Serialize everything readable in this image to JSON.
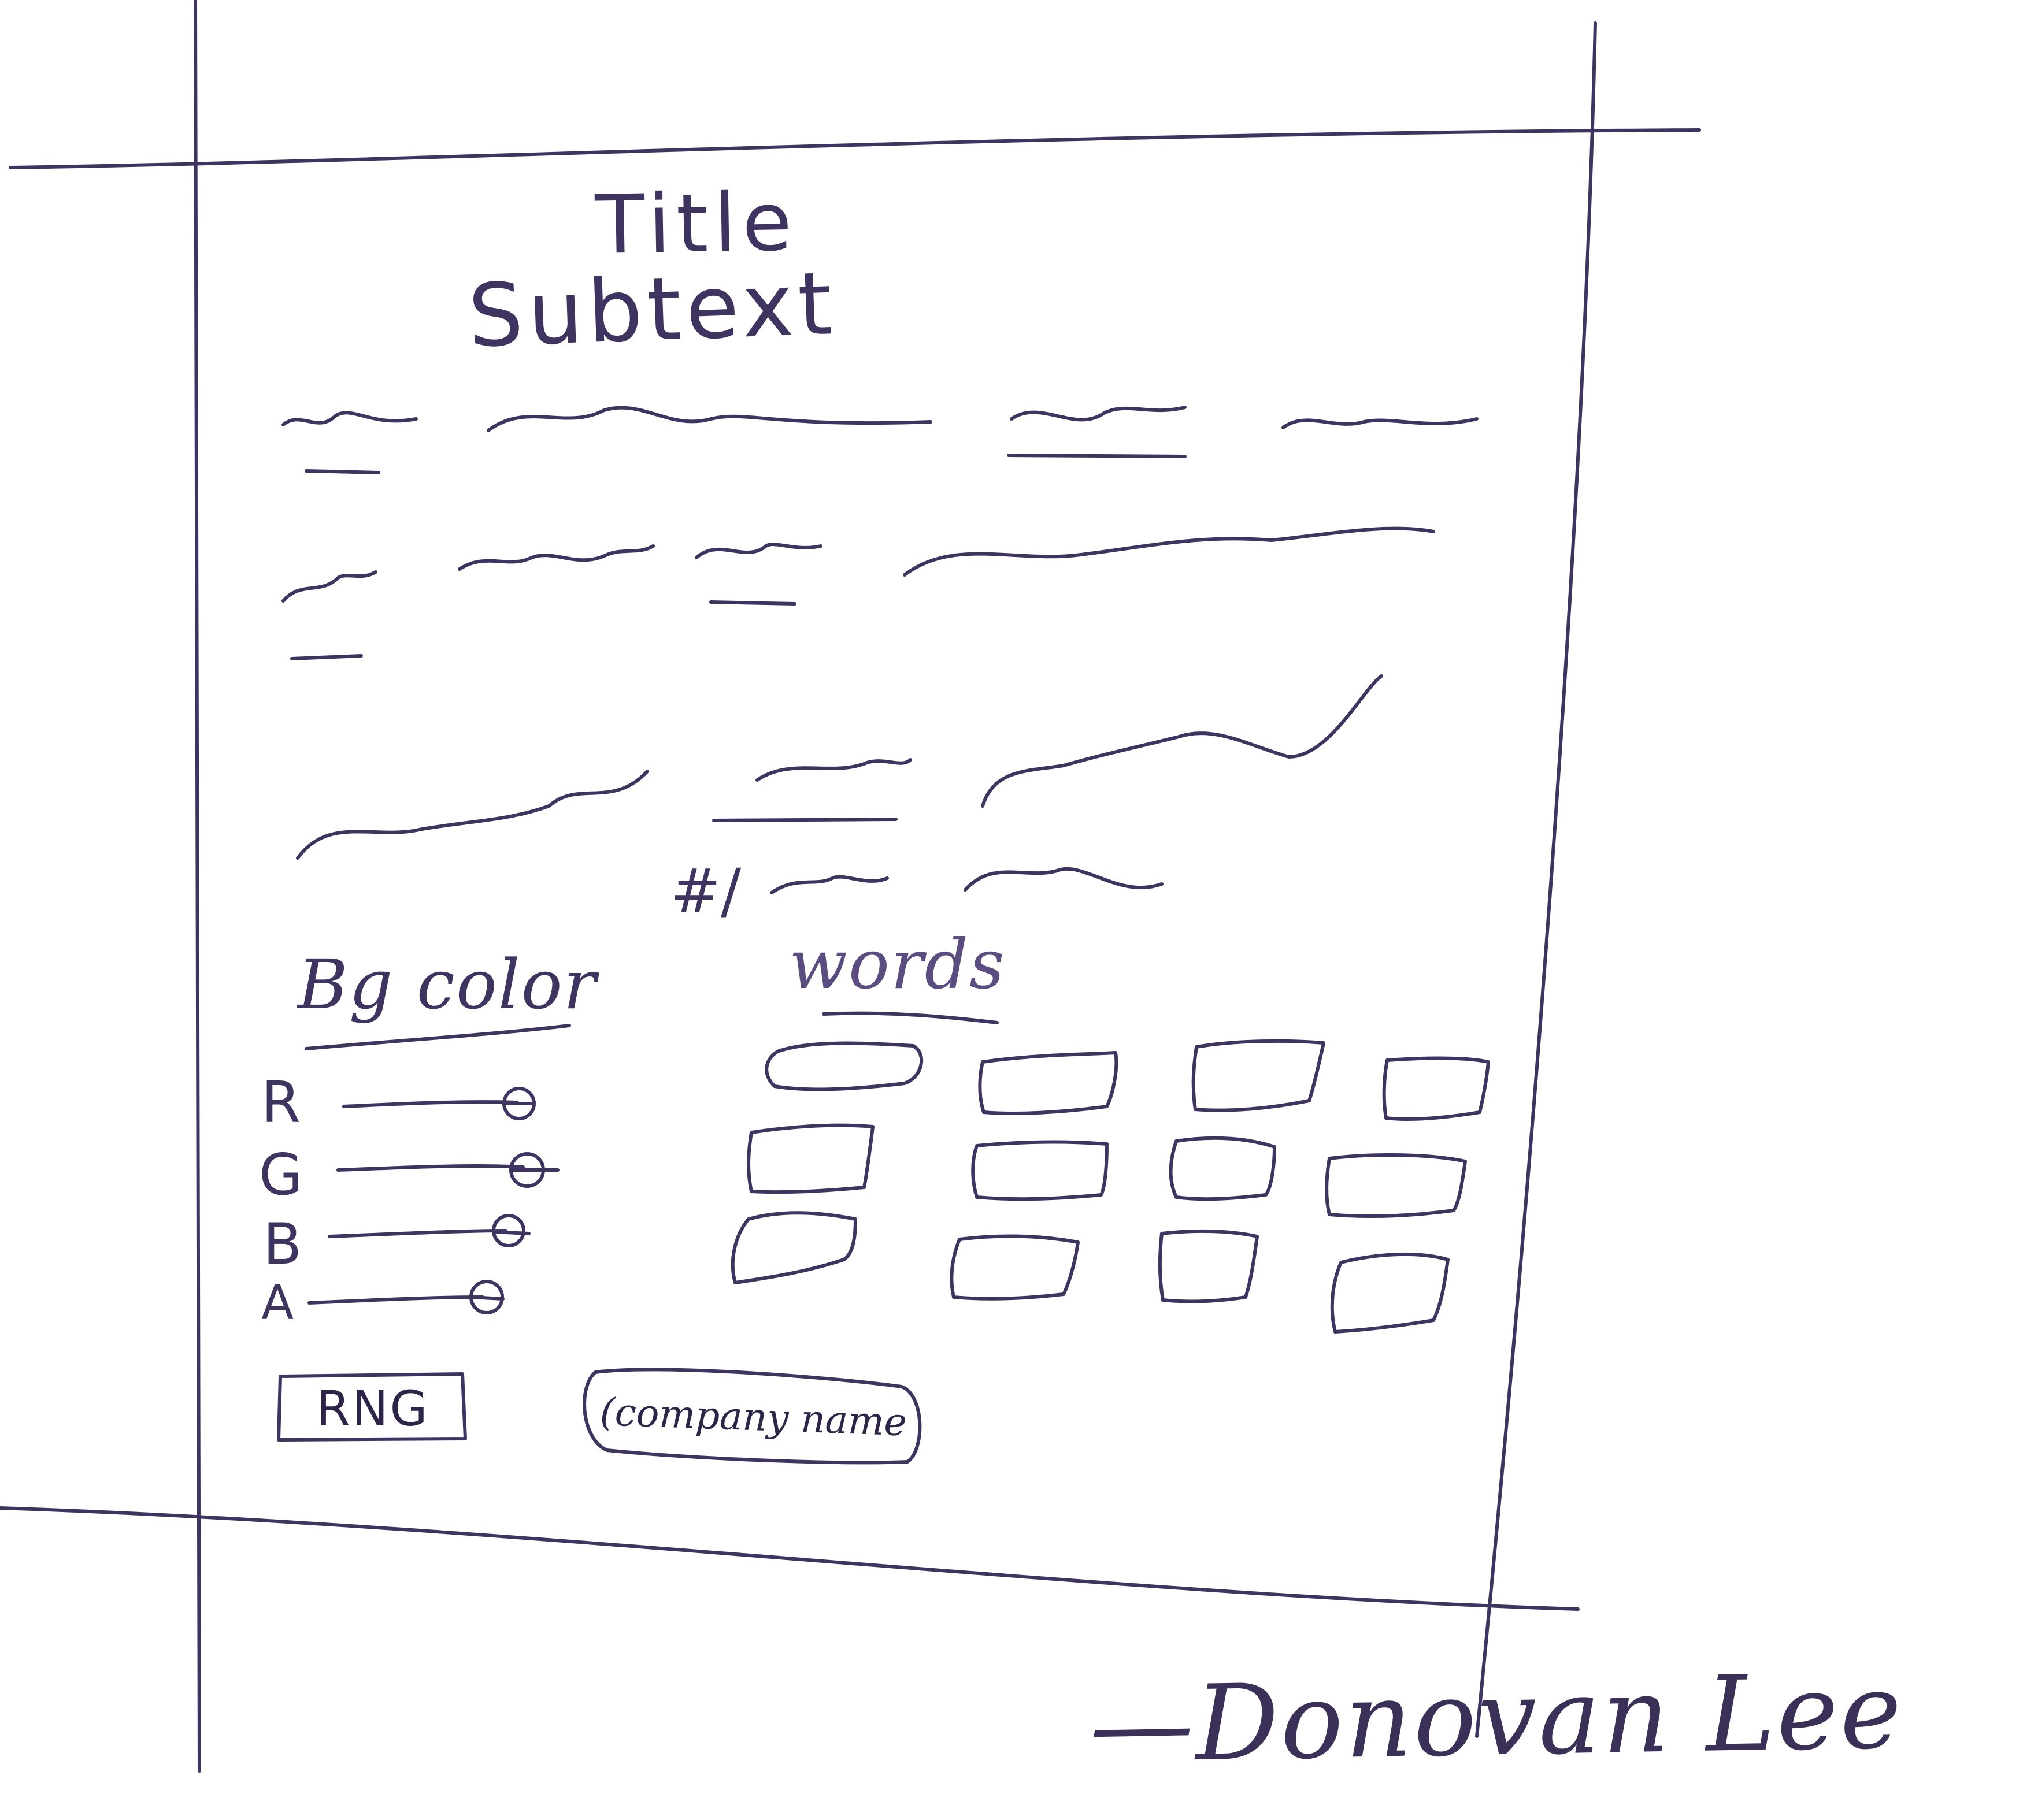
{
  "header": {
    "title": "Title",
    "subtext": "Subtext"
  },
  "content": {
    "count_prefix": "#/"
  },
  "bg_color": {
    "label": "Bg color",
    "channels": [
      {
        "label": "R",
        "value": 1.0
      },
      {
        "label": "G",
        "value": 1.0
      },
      {
        "label": "B",
        "value": 1.0
      },
      {
        "label": "A",
        "value": 1.0
      }
    ]
  },
  "words": {
    "label": "words",
    "box_count": 12
  },
  "buttons": {
    "rng": "RNG",
    "company": "(company name"
  },
  "signature": "—Donovan Lee",
  "colors": {
    "ink": "#3f3460",
    "paper": "#ffffff"
  }
}
